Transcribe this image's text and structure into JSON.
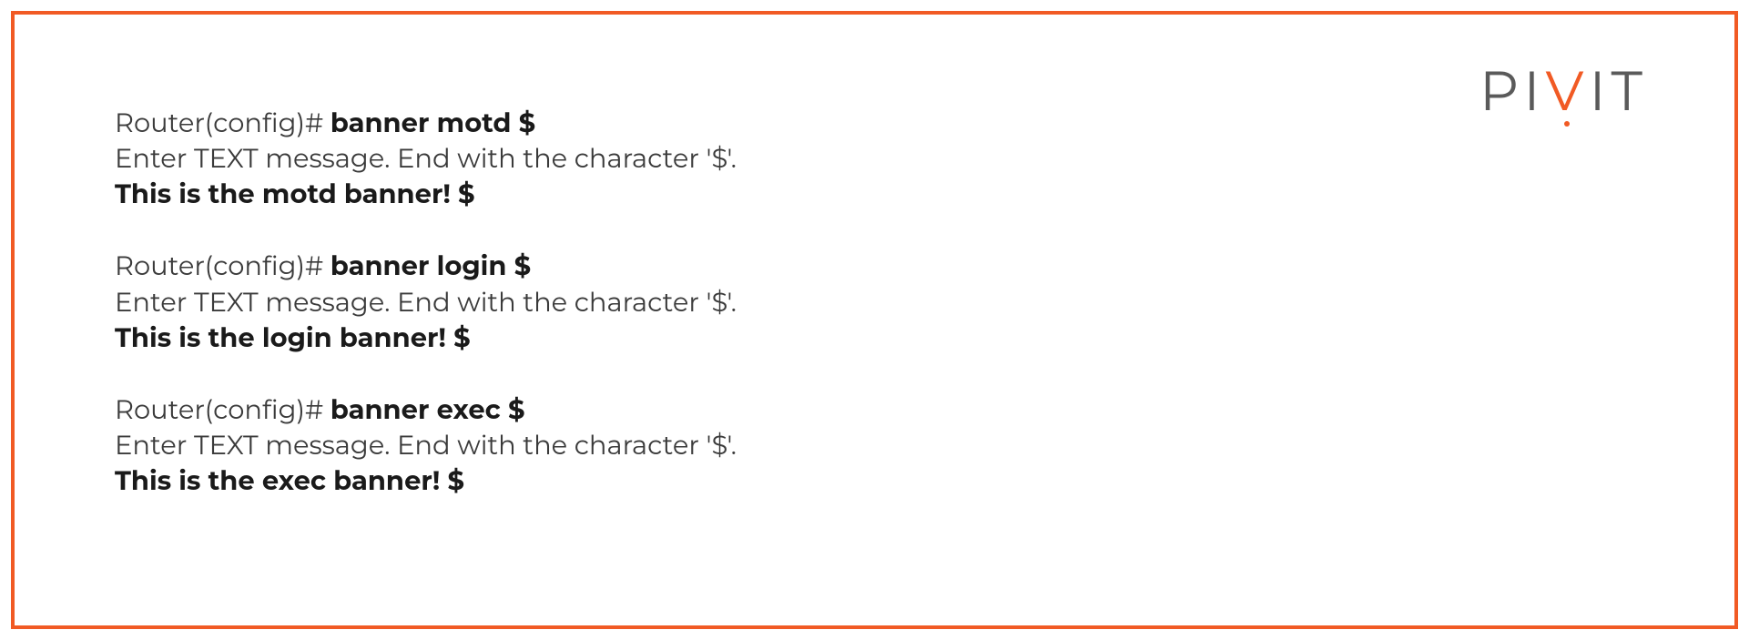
{
  "logo": {
    "part1": "PI",
    "accent": "V",
    "part2": "IT"
  },
  "blocks": [
    {
      "prompt_prefix": "Router(config)# ",
      "prompt_command": "banner motd $",
      "info": "Enter TEXT message. End with the character '$'.",
      "input": "This is the motd banner! $"
    },
    {
      "prompt_prefix": "Router(config)# ",
      "prompt_command": "banner login $",
      "info": "Enter TEXT message. End with the character '$'.",
      "input": "This is the login banner! $"
    },
    {
      "prompt_prefix": "Router(config)# ",
      "prompt_command": "banner exec $",
      "info": "Enter TEXT message. End with the character '$'.",
      "input": "This is the exec banner! $"
    }
  ]
}
